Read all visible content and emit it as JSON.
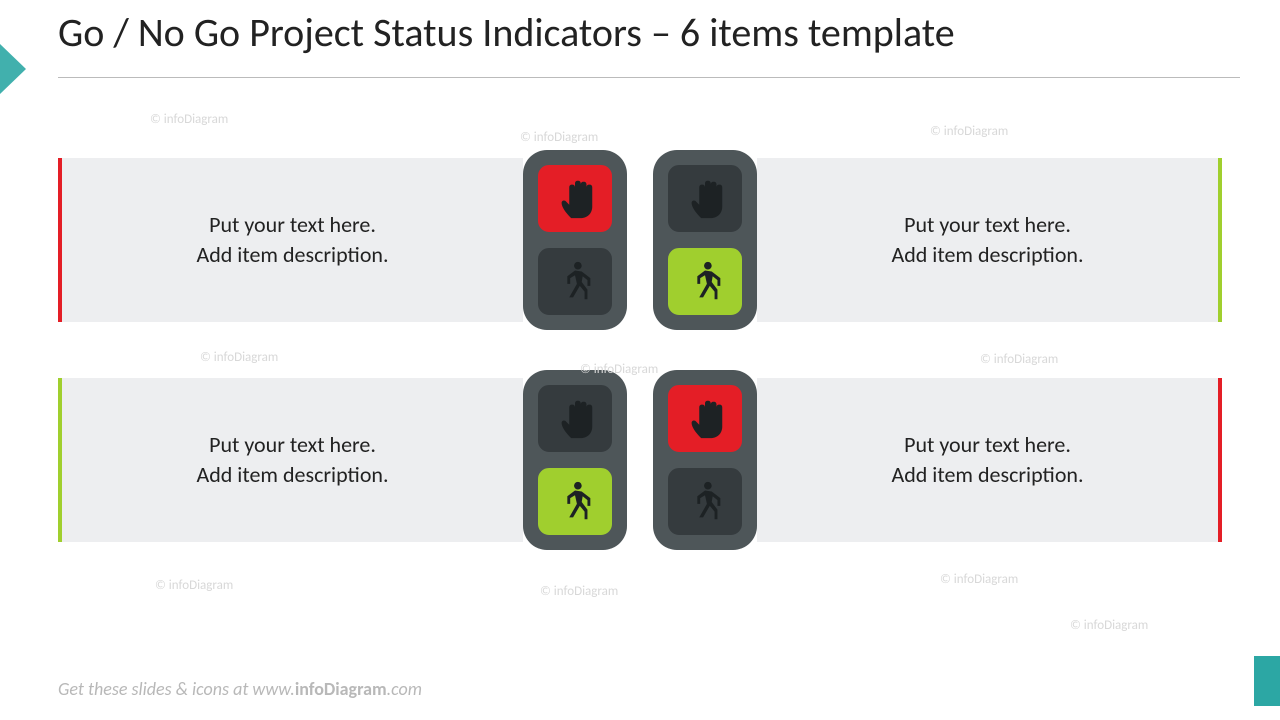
{
  "title": "Go / No Go Project Status Indicators – 6 items template",
  "placeholder": {
    "line1": "Put your text here.",
    "line2": "Add item description."
  },
  "items": [
    {
      "side": "left",
      "status": "nogo"
    },
    {
      "side": "right",
      "status": "go"
    },
    {
      "side": "left",
      "status": "go"
    },
    {
      "side": "right",
      "status": "nogo"
    }
  ],
  "colors": {
    "go": "#a0cf2e",
    "nogo": "#e41e26",
    "signal_body": "#4e5659",
    "signal_lens_off": "#353b3e",
    "accent_teal": "#2ca7a4"
  },
  "watermark_text": "© infoDiagram",
  "footer_prefix": "Get these slides & icons at www.",
  "footer_brand": "infoDiagram",
  "footer_suffix": ".com"
}
